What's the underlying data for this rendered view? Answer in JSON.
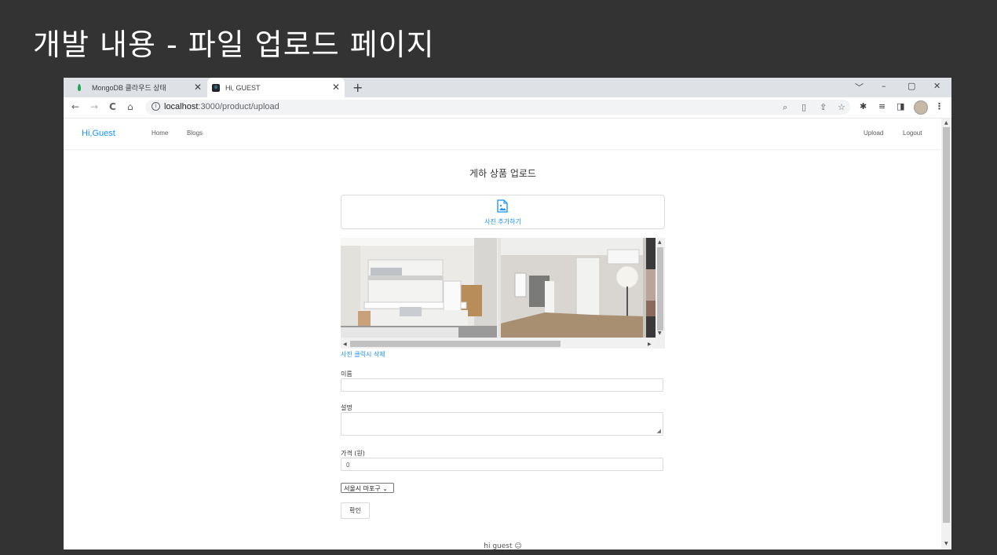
{
  "slide": {
    "title": "개발 내용 - 파일 업로드 페이지"
  },
  "browser": {
    "tabs": [
      {
        "label": "MongoDB 클라우드 상태",
        "close": "✕"
      },
      {
        "label": "Hi, GUEST",
        "close": "✕"
      }
    ],
    "new_tab": "+",
    "window_controls": {
      "tab_search": "﹀",
      "minimize": "–",
      "maximize": "▢",
      "close": "✕"
    },
    "nav": {
      "back": "←",
      "forward": "→",
      "reload": "C",
      "home": "⌂"
    },
    "url_host": "localhost",
    "url_path": ":3000/product/upload",
    "omni_icons": {
      "zoom": "⌕",
      "page": "▯",
      "share": "⇪",
      "bookmark": "☆"
    },
    "ext_icons": {
      "extensions": "✱",
      "media": "≡",
      "sidepanel": "◨",
      "menu": "⋮"
    }
  },
  "app": {
    "brand": "Hi,Guest",
    "nav_left": [
      "Home",
      "Blogs"
    ],
    "nav_right": [
      "Upload",
      "Logout"
    ],
    "page_title": "게하 상품 업로드",
    "add_photo": "사진 추가하기",
    "delete_hint": "사진 클릭시 삭제",
    "form": {
      "name_label": "이름",
      "name_value": "",
      "desc_label": "설명",
      "price_label": "가격 (원)",
      "price_value": "0",
      "region_selected": "서울시 마포구",
      "submit": "확인"
    },
    "footer": "hi guest ☺"
  },
  "colors": {
    "accent": "#1890ff",
    "background": "#333333",
    "tabbar": "#dee1e6"
  }
}
